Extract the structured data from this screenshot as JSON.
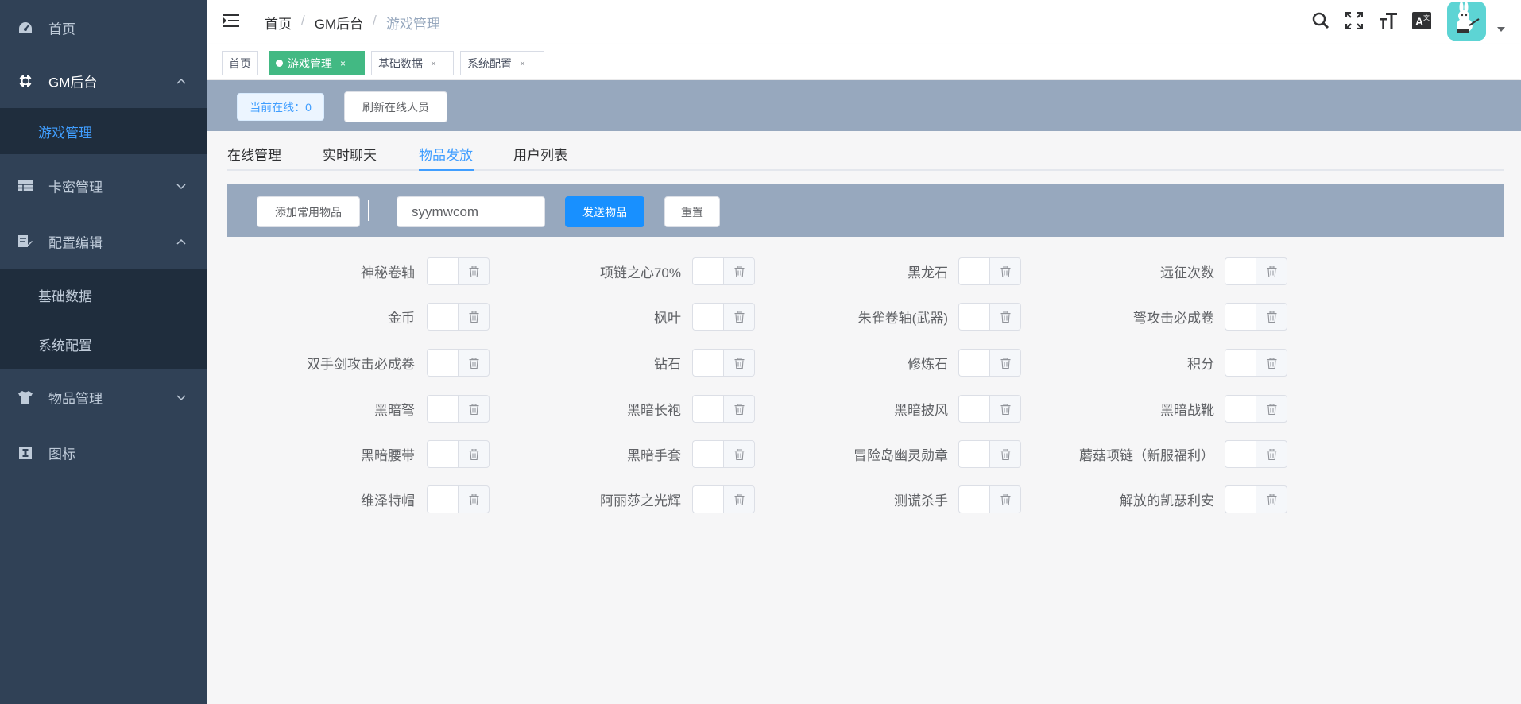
{
  "sidebar": {
    "items": [
      {
        "label": "首页",
        "icon": "dashboard-icon"
      },
      {
        "label": "GM后台",
        "icon": "lifebuoy-icon",
        "expanded": true,
        "children": [
          {
            "label": "游戏管理",
            "active": true
          }
        ]
      },
      {
        "label": "卡密管理",
        "icon": "table-icon",
        "expanded": false
      },
      {
        "label": "配置编辑",
        "icon": "edit-icon",
        "expanded": true,
        "children": [
          {
            "label": "基础数据"
          },
          {
            "label": "系统配置"
          }
        ]
      },
      {
        "label": "物品管理",
        "icon": "shirt-icon",
        "expanded": false
      },
      {
        "label": "图标",
        "icon": "icon-icon"
      }
    ]
  },
  "breadcrumb": [
    "首页",
    "GM后台",
    "游戏管理"
  ],
  "navbar_icons": [
    "search-icon",
    "fullscreen-icon",
    "font-size-icon",
    "translate-icon"
  ],
  "tags": [
    {
      "label": "首页",
      "active": false,
      "closable": false
    },
    {
      "label": "游戏管理",
      "active": true,
      "closable": true
    },
    {
      "label": "基础数据",
      "active": false,
      "closable": true
    },
    {
      "label": "系统配置",
      "active": false,
      "closable": true
    }
  ],
  "tag_close": "×",
  "online": {
    "label": "当前在线：0"
  },
  "refresh_button": "刷新在线人员",
  "tabs": [
    {
      "label": "在线管理",
      "active": false
    },
    {
      "label": "实时聊天",
      "active": false
    },
    {
      "label": "物品发放",
      "active": true
    },
    {
      "label": "用户列表",
      "active": false
    }
  ],
  "toolbar": {
    "add_button": "添加常用物品",
    "input_value": "syymwcom",
    "send_button": "发送物品",
    "reset_button": "重置"
  },
  "items": [
    [
      "神秘卷轴",
      "项链之心70%",
      "黑龙石",
      "远征次数"
    ],
    [
      "金币",
      "枫叶",
      "朱雀卷轴(武器)",
      "弩攻击必成卷"
    ],
    [
      "双手剑攻击必成卷",
      "钻石",
      "修炼石",
      "积分"
    ],
    [
      "黑暗弩",
      "黑暗长袍",
      "黑暗披风",
      "黑暗战靴"
    ],
    [
      "黑暗腰带",
      "黑暗手套",
      "冒险岛幽灵勋章",
      "蘑菇项链（新服福利）"
    ],
    [
      "维泽特帽",
      "阿丽莎之光辉",
      "测谎杀手",
      "解放的凯瑟利安"
    ]
  ],
  "colors": {
    "sidebar": "#304156",
    "submenu": "#1f2d3d",
    "active": "#409eff",
    "tag_active": "#42b983",
    "strip": "#97a8be",
    "primary": "#1890ff"
  }
}
